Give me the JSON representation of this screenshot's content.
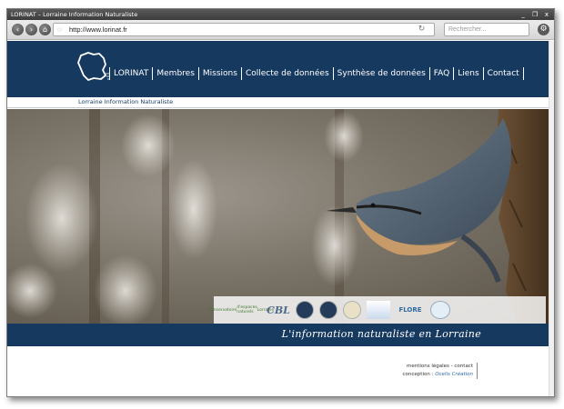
{
  "window": {
    "title": "LORINAT – Lorraine Information Naturaliste",
    "controls": {
      "minimize": "_",
      "restore": "❐",
      "close": "x"
    }
  },
  "browser": {
    "url": "http://www.lorinat.fr",
    "search_placeholder": "Rechercher...",
    "back_glyph": "‹",
    "forward_glyph": "›",
    "home_glyph": "⌂",
    "reload_glyph": "↻",
    "gear_glyph": "⚙"
  },
  "site": {
    "nav": [
      {
        "label": "LORINAT"
      },
      {
        "label": "Membres"
      },
      {
        "label": "Missions"
      },
      {
        "label": "Collecte de données"
      },
      {
        "label": "Synthèse de données"
      },
      {
        "label": "FAQ"
      },
      {
        "label": "Liens"
      },
      {
        "label": "Contact"
      }
    ],
    "subtitle": "Lorraine Information Naturaliste",
    "tagline": "L'information naturaliste en Lorraine",
    "partners": {
      "cen_line1": "Conservatoire",
      "cen_line2": "d'espaces naturels",
      "cen_line3": "Lorraine",
      "cbl": "CBL",
      "flore": "FLORE"
    },
    "footer": {
      "legal": "mentions légales",
      "separator": " - ",
      "contact": "contact",
      "credit_prefix": "conception : ",
      "credit_link": "Ocelis Création"
    }
  },
  "colors": {
    "brand_navy": "#16395f",
    "white": "#ffffff"
  }
}
